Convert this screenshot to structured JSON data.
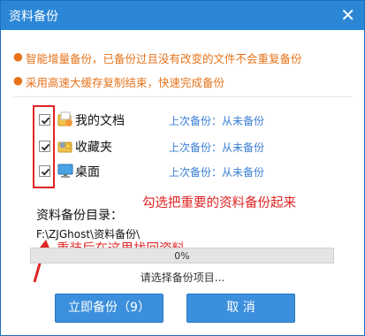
{
  "window": {
    "title": "资料备份",
    "close_glyph": "✕"
  },
  "tips": [
    {
      "bullet": "●",
      "text": "智能增量备份，已备份过且没有改变的文件不会重复备份"
    },
    {
      "bullet": "●",
      "text": "采用高速大缓存复制结束，快速完成备份"
    }
  ],
  "items": [
    {
      "label": "我的文档",
      "status": "上次备份：从未备份",
      "checked": true,
      "icon": "documents-icon"
    },
    {
      "label": "收藏夹",
      "status": "上次备份：从未备份",
      "checked": true,
      "icon": "favorites-icon"
    },
    {
      "label": "桌面",
      "status": "上次备份：从未备份",
      "checked": true,
      "icon": "desktop-icon"
    }
  ],
  "annotations": {
    "main": "勾选把重要的资料备份起来",
    "sub": "重装后在这里找回资料"
  },
  "backup_dir": {
    "label": "资料备份目录：",
    "path": "F:\\ZJGhost\\资料备份\\"
  },
  "progress": {
    "value": 0,
    "text": "0%"
  },
  "status": "请选择备份项目...",
  "buttons": {
    "backup": "立即备份（9）",
    "cancel": "取 消"
  },
  "colors": {
    "titlebar": "#2b86d6",
    "tip_text": "#e6731b",
    "annotation": "#e02424",
    "status_link": "#3a7fd4",
    "button": "#3b8fdc"
  }
}
